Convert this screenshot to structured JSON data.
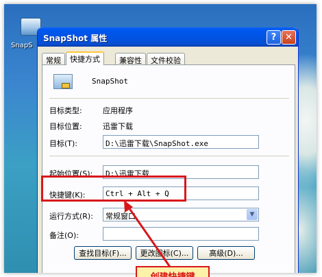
{
  "desktop": {
    "icon_label": "SnapS"
  },
  "window": {
    "title": "SnapShot 属性",
    "help_button": "?",
    "close_button": "✕",
    "tabs": [
      "常规",
      "快捷方式",
      "兼容性",
      "文件校验"
    ],
    "active_tab": "快捷方式"
  },
  "shortcut": {
    "app_name": "SnapShot",
    "target_type_label": "目标类型:",
    "target_type_value": "应用程序",
    "target_location_label": "目标位置:",
    "target_location_value": "迅雷下载",
    "target_label": "目标(T):",
    "target_value": "D:\\迅雷下载\\SnapShot.exe",
    "start_in_label": "起始位置(S):",
    "start_in_value": "D:\\迅雷下载",
    "shortcut_key_label": "快捷键(K):",
    "shortcut_key_value": "Ctrl + Alt + Q",
    "run_label": "运行方式(R):",
    "run_value": "常规窗口",
    "comment_label": "备注(O):",
    "comment_value": "",
    "find_target_button": "查找目标(F)...",
    "change_icon_button": "更改图标(C)...",
    "advanced_button": "高级(D)..."
  },
  "annotation": {
    "callout_text": "创建快捷键",
    "accent_color": "#d8161a"
  }
}
